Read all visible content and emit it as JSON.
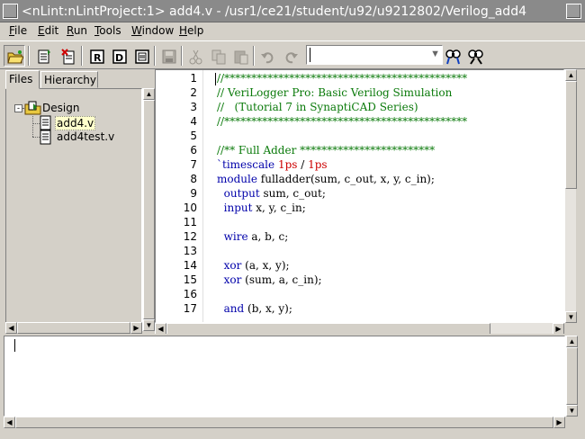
{
  "window": {
    "title": "<nLint:nLintProject:1> add4.v - /usr1/ce21/student/u92/u9212802/Verilog_add4"
  },
  "menu": [
    {
      "label": "File",
      "u": "F",
      "rest": "ile"
    },
    {
      "label": "Edit",
      "u": "E",
      "rest": "dit"
    },
    {
      "label": "Run",
      "u": "R",
      "rest": "un"
    },
    {
      "label": "Tools",
      "u": "T",
      "rest": "ools"
    },
    {
      "label": "Window",
      "u": "W",
      "rest": "indow"
    },
    {
      "label": "Help",
      "u": "H",
      "rest": "elp"
    }
  ],
  "toolbar": {
    "icons": [
      "open-folder-icon",
      "import-file-icon",
      "remove-file-icon",
      "run-icon",
      "debug-icon",
      "report-icon",
      "save-icon",
      "cut-icon",
      "copy-icon",
      "paste-icon",
      "undo-icon",
      "redo-icon",
      "find-icon",
      "find-next-icon"
    ],
    "search_value": ""
  },
  "left_panel": {
    "tabs": [
      "Files",
      "Hierarchy"
    ],
    "active_tab": "Files",
    "tree": {
      "root": "Design",
      "expander": "-",
      "files": [
        "add4.v",
        "add4test.v"
      ],
      "selected": "add4.v"
    }
  },
  "editor": {
    "lines": [
      {
        "n": "1",
        "parts": [
          {
            "t": "//*********************************************",
            "c": "comment"
          }
        ]
      },
      {
        "n": "2",
        "parts": [
          {
            "t": "// VeriLogger Pro: Basic Verilog Simulation",
            "c": "comment"
          }
        ]
      },
      {
        "n": "3",
        "parts": [
          {
            "t": "//   (Tutorial 7 in SynaptiCAD Series)",
            "c": "comment"
          }
        ]
      },
      {
        "n": "4",
        "parts": [
          {
            "t": "//*********************************************",
            "c": "comment"
          }
        ]
      },
      {
        "n": "5",
        "parts": []
      },
      {
        "n": "6",
        "parts": [
          {
            "t": "//** Full Adder *************************",
            "c": "comment"
          }
        ]
      },
      {
        "n": "7",
        "parts": [
          {
            "t": "`timescale ",
            "c": "kw"
          },
          {
            "t": "1ps",
            "c": "num"
          },
          {
            "t": " / ",
            "c": "plain"
          },
          {
            "t": "1ps",
            "c": "num"
          }
        ]
      },
      {
        "n": "8",
        "parts": [
          {
            "t": "module",
            "c": "kw"
          },
          {
            "t": " fulladder(sum, c_out, x, y, c_in);",
            "c": "plain"
          }
        ]
      },
      {
        "n": "9",
        "parts": [
          {
            "t": "  output",
            "c": "kw"
          },
          {
            "t": " sum, c_out;",
            "c": "plain"
          }
        ]
      },
      {
        "n": "10",
        "parts": [
          {
            "t": "  input",
            "c": "kw"
          },
          {
            "t": " x, y, c_in;",
            "c": "plain"
          }
        ]
      },
      {
        "n": "11",
        "parts": []
      },
      {
        "n": "12",
        "parts": [
          {
            "t": "  wire",
            "c": "kw"
          },
          {
            "t": " a, b, c;",
            "c": "plain"
          }
        ]
      },
      {
        "n": "13",
        "parts": []
      },
      {
        "n": "14",
        "parts": [
          {
            "t": "  xor",
            "c": "kw"
          },
          {
            "t": " (a, x, y);",
            "c": "plain"
          }
        ]
      },
      {
        "n": "15",
        "parts": [
          {
            "t": "  xor",
            "c": "kw"
          },
          {
            "t": " (sum, a, c_in);",
            "c": "plain"
          }
        ]
      },
      {
        "n": "16",
        "parts": []
      },
      {
        "n": "17",
        "parts": [
          {
            "t": "  and",
            "c": "kw"
          },
          {
            "t": " (b, x, y);",
            "c": "plain"
          }
        ]
      }
    ]
  },
  "output": {
    "text": ""
  }
}
